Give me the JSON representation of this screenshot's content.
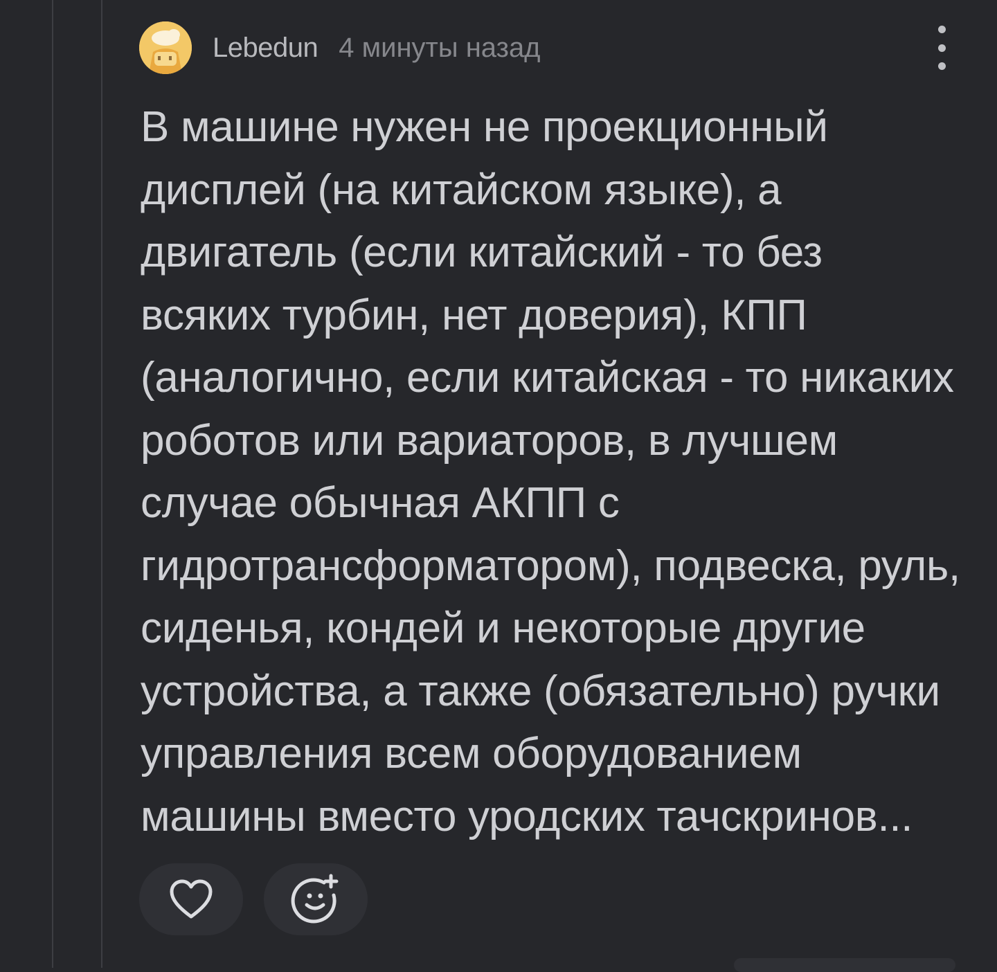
{
  "comment": {
    "author": "Lebedun",
    "time": "4 минуты назад",
    "text": "В машине нужен не проекционный\nдисплей (на китайском языке), а\nдвигатель (если китайский - то без\nвсяких турбин, нет доверия), КПП\n(аналогично, если китайская - то никаких\nроботов или вариаторов, в лучшем\nслучае обычная АКПП с\nгидротрансформатором), подвеска, руль,\nсиденья, кондей и некоторые другие\nустройства, а также (обязательно) ручки\nуправления всем оборудованием\nмашины вместо уродских тачскринов..."
  },
  "icons": {
    "more": "more-vertical-icon",
    "like": "heart-outline-icon",
    "react": "smiley-plus-icon"
  },
  "colors": {
    "background": "#26272b",
    "text": "#cfd0d4",
    "muted": "#86878c",
    "button": "#2f3035"
  }
}
